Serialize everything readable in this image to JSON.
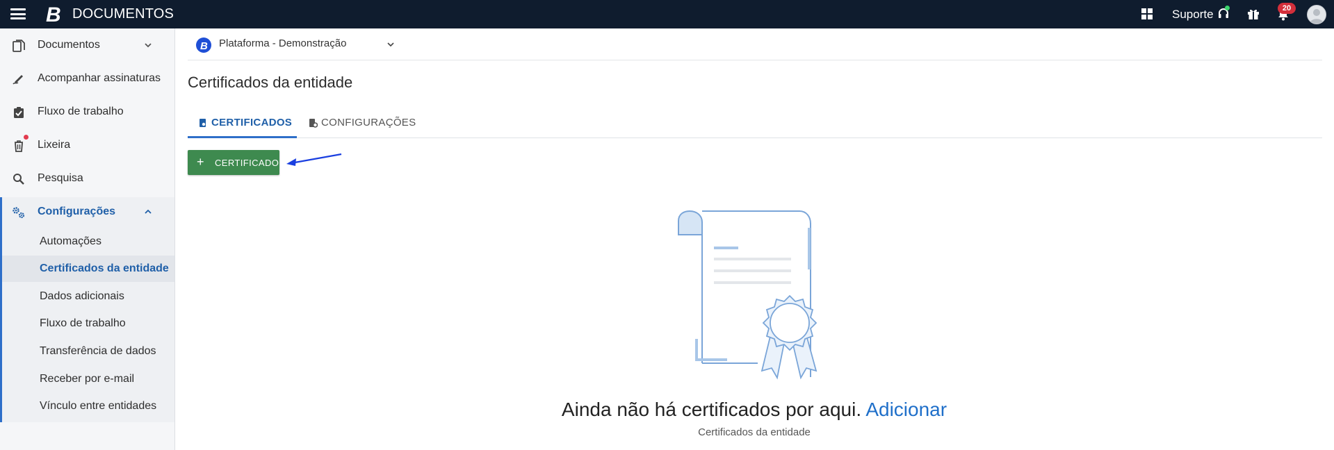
{
  "header": {
    "brand": "DOCUMENTOS",
    "suporte": "Suporte",
    "notifications_count": "20"
  },
  "sidebar": {
    "items": [
      {
        "label": "Documentos"
      },
      {
        "label": "Acompanhar assinaturas"
      },
      {
        "label": "Fluxo de trabalho"
      },
      {
        "label": "Lixeira"
      },
      {
        "label": "Pesquisa"
      },
      {
        "label": "Configurações"
      }
    ],
    "config_sub": [
      {
        "label": "Automações"
      },
      {
        "label": "Certificados da entidade"
      },
      {
        "label": "Dados adicionais"
      },
      {
        "label": "Fluxo de trabalho"
      },
      {
        "label": "Transferência de dados"
      },
      {
        "label": "Receber por e-mail"
      },
      {
        "label": "Vínculo entre entidades"
      }
    ]
  },
  "main": {
    "platform": "Plataforma - Demonstração",
    "title": "Certificados da entidade",
    "tabs": [
      {
        "label": "CERTIFICADOS"
      },
      {
        "label": "CONFIGURAÇÕES"
      }
    ],
    "add_button": "CERTIFICADO",
    "empty": {
      "message": "Ainda não há certificados por aqui.",
      "link": "Adicionar",
      "subtitle": "Certificados da entidade"
    }
  },
  "colors": {
    "topbar": "#0f1c2e",
    "accent": "#2e6fc9",
    "button": "#3e8a4f"
  }
}
